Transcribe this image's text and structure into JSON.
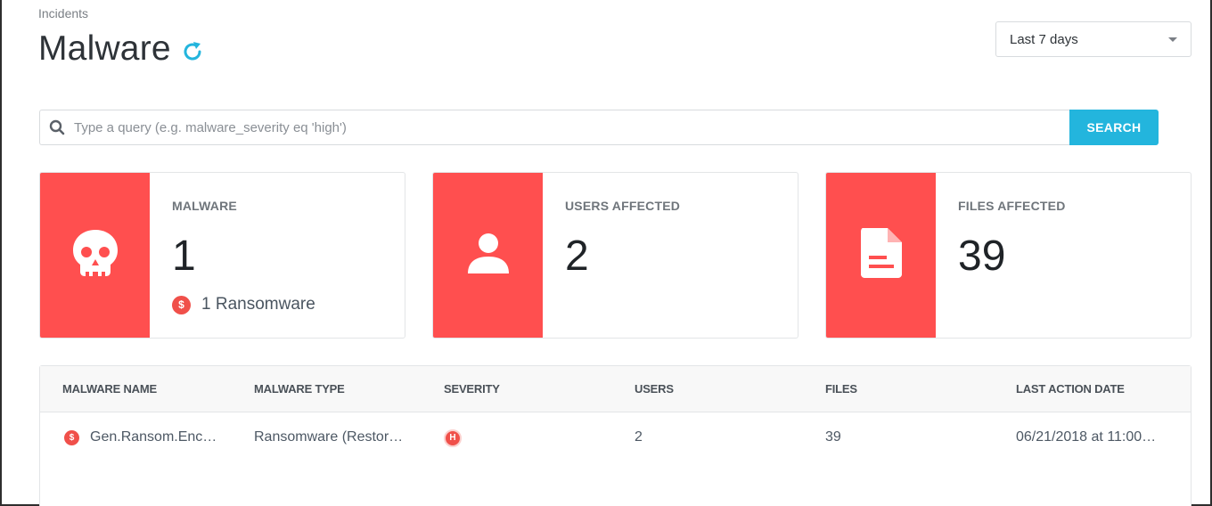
{
  "breadcrumb": "Incidents",
  "title": "Malware",
  "date_range": {
    "selected": "Last 7 days"
  },
  "search": {
    "placeholder": "Type a query (e.g. malware_severity eq 'high')",
    "value": "",
    "button_label": "SEARCH"
  },
  "stats": [
    {
      "label": "MALWARE",
      "value": "1",
      "icon": "skull-icon",
      "sub_icon": "$",
      "sub_text": "1 Ransomware"
    },
    {
      "label": "USERS AFFECTED",
      "value": "2",
      "icon": "user-icon"
    },
    {
      "label": "FILES AFFECTED",
      "value": "39",
      "icon": "file-icon"
    }
  ],
  "table": {
    "columns": [
      "MALWARE NAME",
      "MALWARE TYPE",
      "SEVERITY",
      "USERS",
      "FILES",
      "LAST ACTION DATE"
    ],
    "rows": [
      {
        "type_icon": "$",
        "name": "Gen.Ransom.Enc…",
        "type": "Ransomware (Restor…",
        "severity": "H",
        "users": "2",
        "files": "39",
        "last_action": "06/21/2018 at 11:00…"
      }
    ]
  },
  "colors": {
    "accent": "#23b5dd",
    "danger": "#ff4f4f",
    "badge": "#f0504a"
  }
}
